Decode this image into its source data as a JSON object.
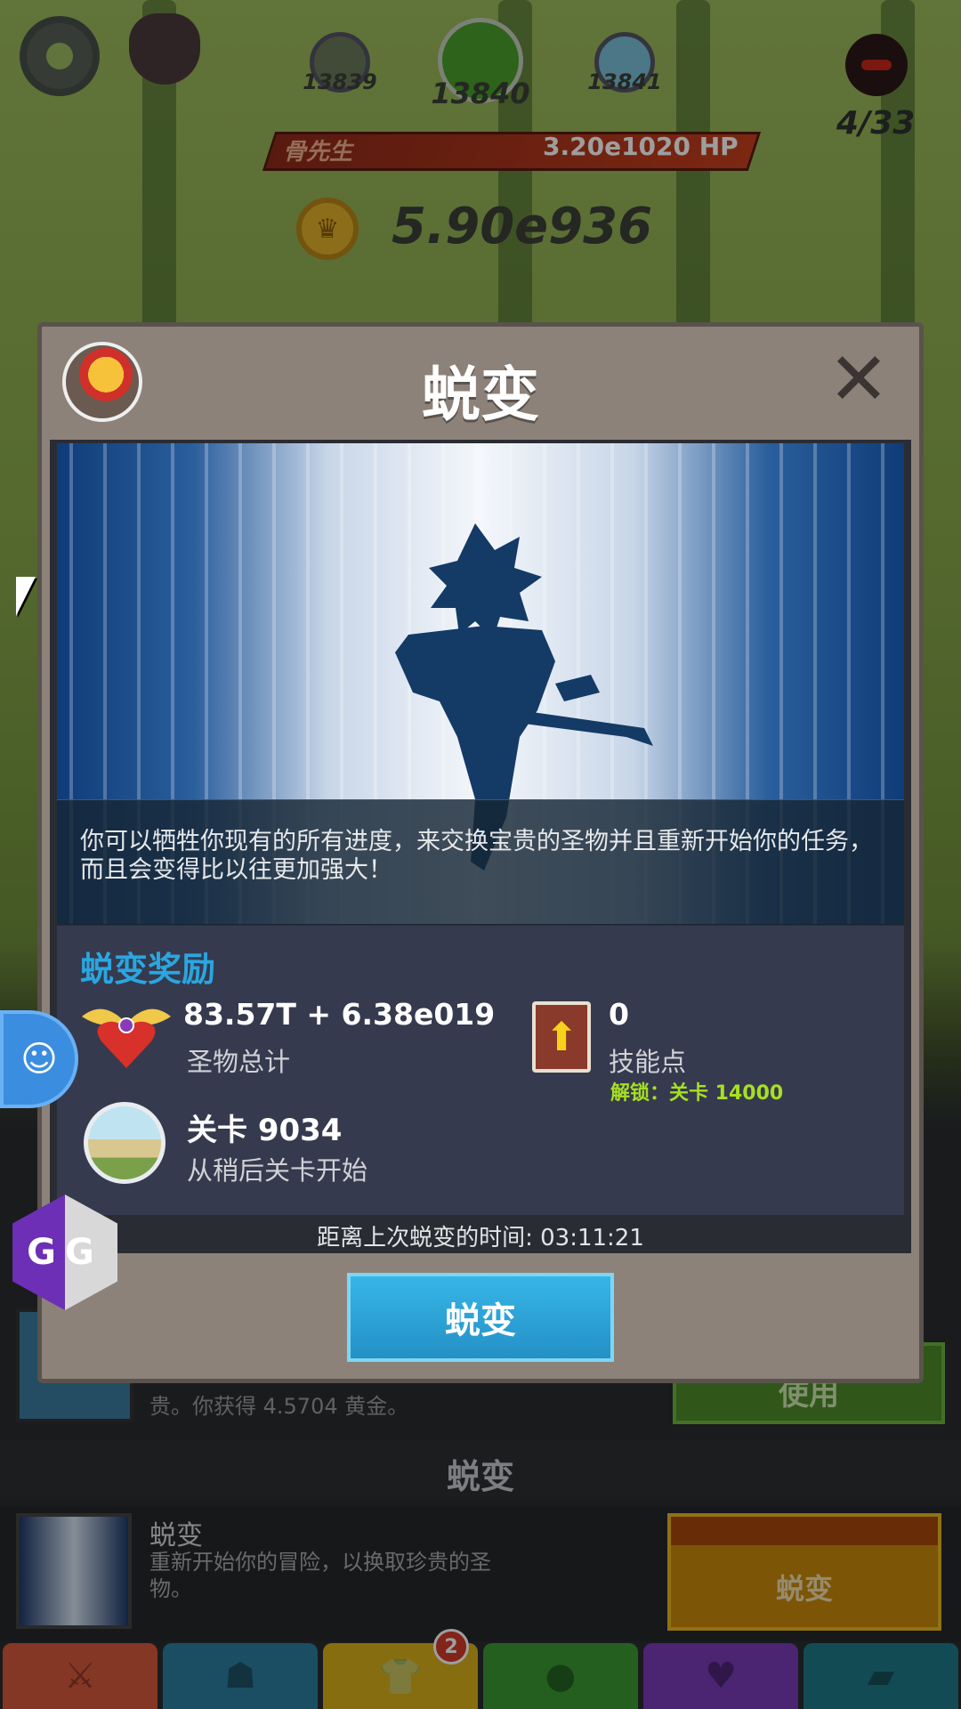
{
  "hud": {
    "stage_prev": "13839",
    "stage_current": "13840",
    "stage_next": "13841",
    "boss_name": "骨先生",
    "boss_hp": "3.20e1020 HP",
    "gold": "5.90e936",
    "boss_kills": "4/33",
    "icons": [
      "gear-icon",
      "boss-shield-icon",
      "coin-icon",
      "demon-icon"
    ]
  },
  "modal": {
    "title": "蜕变",
    "close_label": "✕",
    "description": "你可以牺牲你现有的所有进度，来交换宝贵的圣物并且重新开始你的任务，而且会变得比以往更加强大！",
    "reward_title": "蜕变奖励",
    "relic_value": "83.57T + 6.38e019",
    "relic_label": "圣物总计",
    "skill_points_value": "0",
    "skill_points_label": "技能点",
    "skill_points_unlock": "解锁：关卡 14000",
    "stage_value": "关卡 9034",
    "stage_label": "从稍后关卡开始",
    "timer": "距离上次蜕变的时间: 03:11:21",
    "button_label": "蜕变"
  },
  "page": {
    "behind_button_label": "使用",
    "behind_text": "贵。你获得 4.5704 黄金。",
    "section_title": "蜕变",
    "row_title": "蜕变",
    "row_desc": "重新开始你的冒险，以换取珍贵的圣物。",
    "row_button_label": "蜕变"
  },
  "tabs": [
    {
      "name": "sword-icon",
      "color": "#d65a3a",
      "badge": ""
    },
    {
      "name": "hero-icon",
      "color": "#2d7fa0",
      "badge": ""
    },
    {
      "name": "shirt-icon",
      "color": "#d8b21a",
      "badge": "2"
    },
    {
      "name": "pet-icon",
      "color": "#3a9a34",
      "badge": ""
    },
    {
      "name": "heart-icon",
      "color": "#7a3ab8",
      "badge": ""
    },
    {
      "name": "chest-icon",
      "color": "#1f7a8a",
      "badge": ""
    }
  ],
  "colors": {
    "modal_bg": "#8c8279",
    "accent_blue": "#2aa6e0",
    "unlock_green": "#a6e020",
    "hp_red": "#c8401d"
  }
}
